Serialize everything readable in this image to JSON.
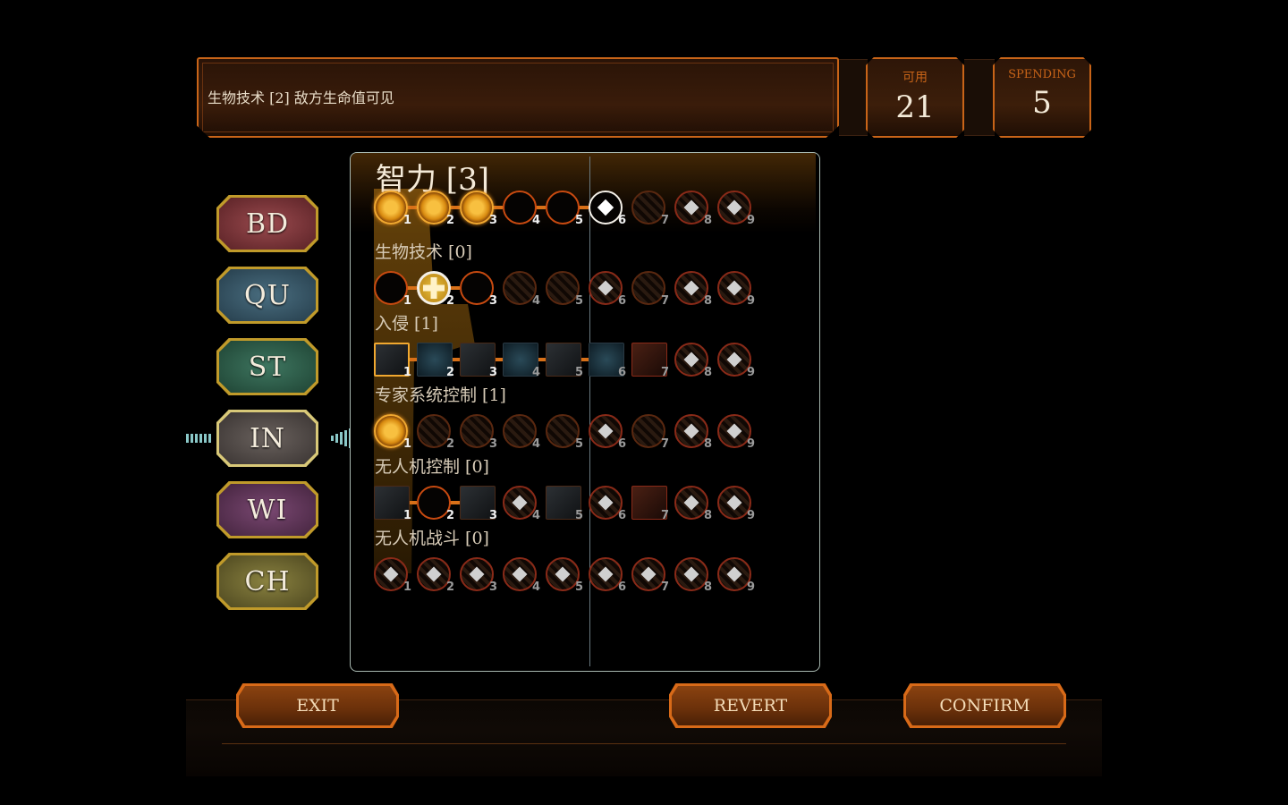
{
  "info": {
    "description": "生物技术 [2] 敌方生命值可见"
  },
  "counters": {
    "available": {
      "label": "可用",
      "value": "21"
    },
    "spending": {
      "label": "SPENDING",
      "value": "5"
    }
  },
  "categories": [
    "BD",
    "QU",
    "ST",
    "IN",
    "WI",
    "CH"
  ],
  "selected_category": "IN",
  "panel": {
    "title": "智力 [3]",
    "rows": [
      {
        "title": "",
        "nodes": [
          "lit",
          "lit",
          "lit",
          "empty",
          "empty",
          "next",
          "hatch",
          "dia",
          "dia"
        ]
      },
      {
        "title": "生物技术 [0]",
        "nodes": [
          "empty",
          "plus",
          "empty",
          "hatch",
          "hatch",
          "dia",
          "hatch",
          "dia",
          "dia"
        ]
      },
      {
        "title": "入侵 [1]",
        "nodes": [
          "img",
          "img",
          "img",
          "img",
          "img",
          "img",
          "img",
          "dia",
          "dia"
        ]
      },
      {
        "title": "专家系统控制 [1]",
        "nodes": [
          "lit",
          "hatch",
          "hatch",
          "hatch",
          "hatch",
          "dia",
          "hatch",
          "dia",
          "dia"
        ]
      },
      {
        "title": "无人机控制 [0]",
        "nodes": [
          "img",
          "empty",
          "img",
          "dia",
          "img",
          "dia",
          "img",
          "dia",
          "dia"
        ]
      },
      {
        "title": "无人机战斗 [0]",
        "nodes": [
          "dia",
          "dia",
          "dia",
          "dia",
          "dia",
          "dia",
          "dia",
          "dia",
          "dia"
        ]
      }
    ],
    "levels": [
      "1",
      "2",
      "3",
      "4",
      "5",
      "6",
      "7",
      "8",
      "9"
    ]
  },
  "buttons": {
    "exit": "EXIT",
    "revert": "REVERT",
    "confirm": "CONFIRM"
  }
}
